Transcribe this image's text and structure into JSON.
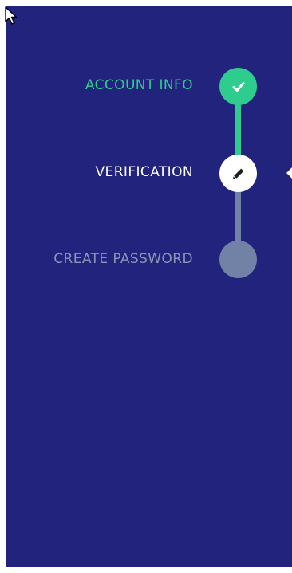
{
  "progress": {
    "steps": [
      {
        "label": "ACCOUNT INFO",
        "state": "complete",
        "icon": "check-icon"
      },
      {
        "label": "VERIFICATION",
        "state": "current",
        "icon": "pencil-icon"
      },
      {
        "label": "CREATE PASSWORD",
        "state": "upcoming",
        "icon": ""
      }
    ]
  },
  "colors": {
    "panel_background": "#22237d",
    "complete": "#2ecd8e",
    "current": "#ffffff",
    "upcoming_label": "#8d94b5",
    "upcoming_circle": "#7282a6"
  }
}
